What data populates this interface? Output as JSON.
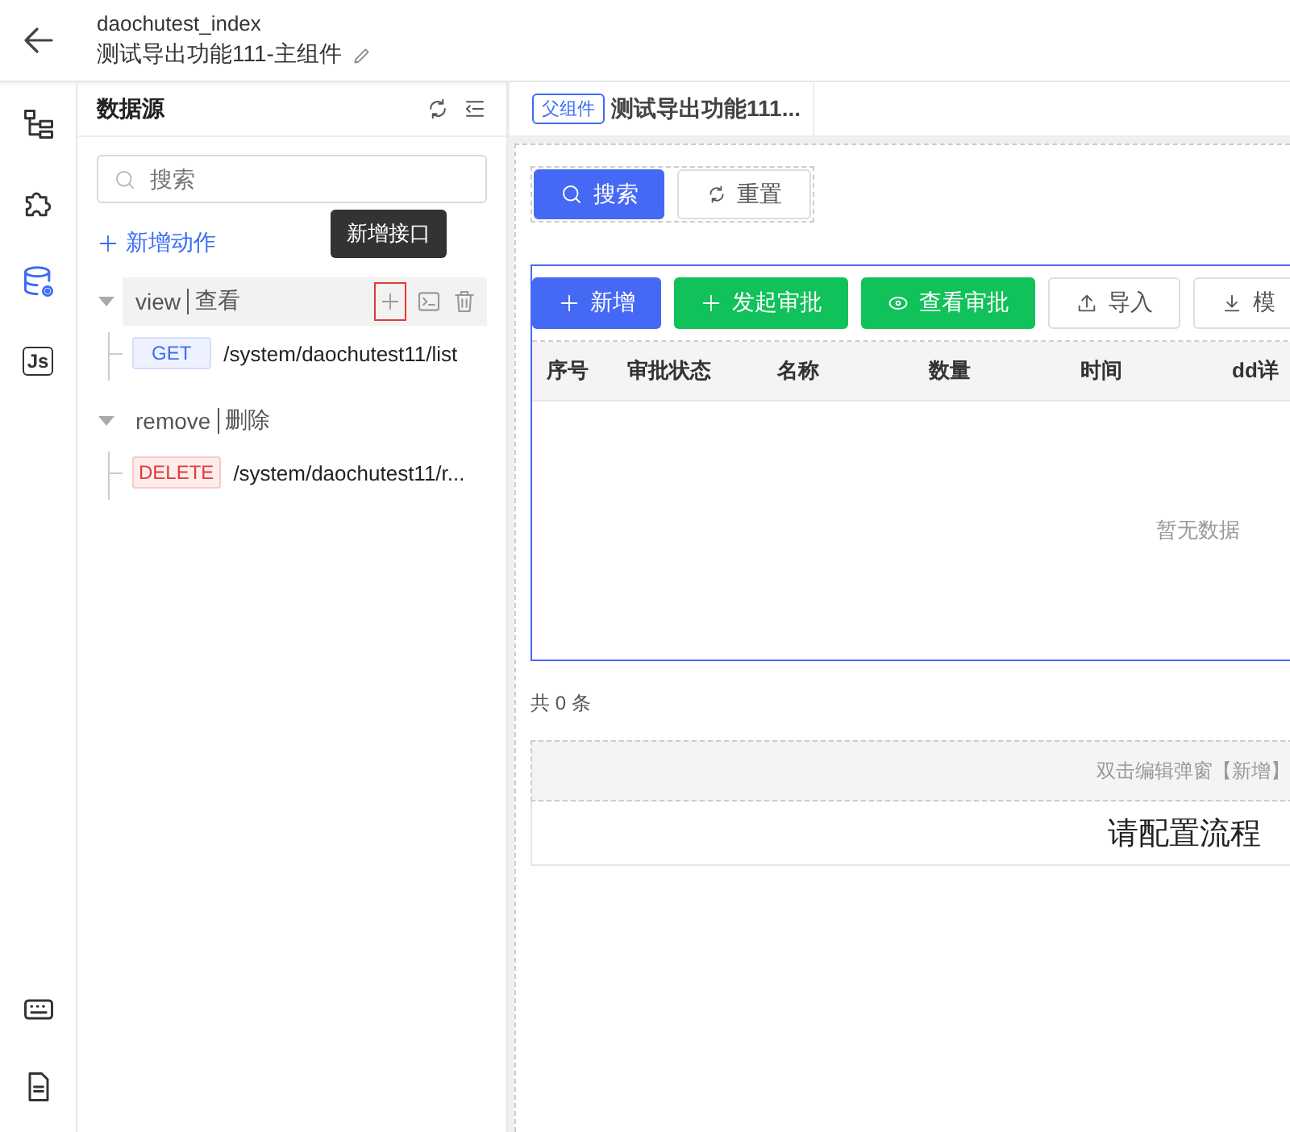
{
  "header": {
    "app_name": "daochutest_index",
    "page_title": "测试导出功能111-主组件"
  },
  "rail": [
    {
      "kind": "tree",
      "selected": false
    },
    {
      "kind": "puzzle",
      "selected": false
    },
    {
      "kind": "database",
      "selected": true
    },
    {
      "kind": "script",
      "label": "Js",
      "selected": false
    },
    {
      "kind": "keyboard",
      "selected": false
    },
    {
      "kind": "document",
      "selected": false
    }
  ],
  "panel": {
    "title": "数据源",
    "search": {
      "placeholder": "搜索"
    },
    "add_action": "新增动作",
    "actions": [
      {
        "name": "view",
        "label": "查看",
        "expanded": true,
        "hovered": true,
        "tooltip": "新增接口",
        "children": [
          {
            "kind": "get",
            "method": "GET",
            "path": "/system/daochutest11/list"
          }
        ]
      },
      {
        "name": "remove",
        "label": "删除",
        "expanded": true,
        "hovered": false,
        "children": [
          {
            "kind": "delete",
            "method": "DELETE",
            "path": "/system/daochutest11/r..."
          }
        ]
      }
    ]
  },
  "tabs": [
    {
      "badge": "父组件",
      "label": "测试导出功能111...",
      "selected": true
    }
  ],
  "search_form": {
    "buttons": [
      {
        "kind": "primary",
        "label": "搜索"
      },
      {
        "kind": "default",
        "label": "重置"
      }
    ]
  },
  "toolbar": [
    {
      "kind": "primary",
      "label": "新增"
    },
    {
      "kind": "success",
      "label": "发起审批"
    },
    {
      "kind": "success",
      "label": "查看审批"
    },
    {
      "kind": "default",
      "label": "导入"
    },
    {
      "kind": "default",
      "label": "模"
    }
  ],
  "table": {
    "columns": [
      "序号",
      "审批状态",
      "名称",
      "数量",
      "时间",
      "dd详"
    ],
    "empty_text": "暂无数据"
  },
  "total": "共 0 条",
  "dialog_hint": "双击编辑弹窗【新增】",
  "flow_hint": "请配置流程"
}
